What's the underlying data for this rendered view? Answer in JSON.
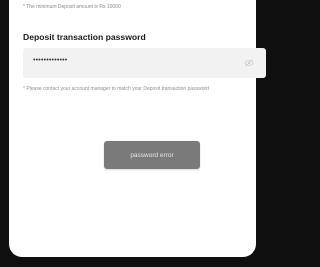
{
  "notice": {
    "minimum_deposit": "* The minimum Deposit amount is Rs 10000"
  },
  "form": {
    "title": "Deposit transaction password",
    "password_value": "•••••••••••••",
    "toggle_icon": "eye-off-icon",
    "help_text": "* Please contact your account manager to match your Deposit transaction password"
  },
  "toast": {
    "message": "password error"
  }
}
